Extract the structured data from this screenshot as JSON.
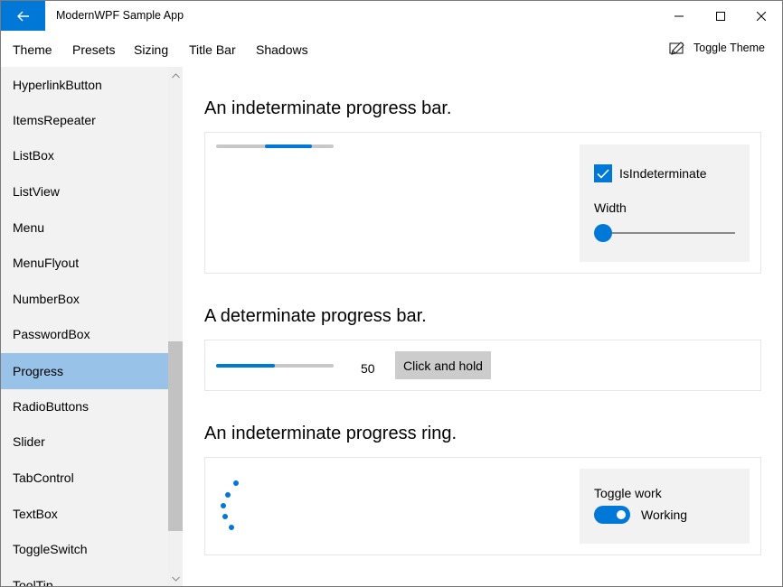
{
  "titlebar": {
    "title": "ModernWPF Sample App",
    "back_icon": "arrow-left-icon",
    "minimize_icon": "minimize-icon",
    "maximize_icon": "maximize-icon",
    "close_icon": "close-icon",
    "accent": "#0078d7"
  },
  "menu": {
    "items": [
      {
        "label": "Theme"
      },
      {
        "label": "Presets"
      },
      {
        "label": "Sizing"
      },
      {
        "label": "Title Bar"
      },
      {
        "label": "Shadows"
      }
    ],
    "toggle_theme_label": "Toggle Theme",
    "toggle_theme_icon": "theme-toggle-icon"
  },
  "sidebar": {
    "items": [
      {
        "label": "HyperlinkButton"
      },
      {
        "label": "ItemsRepeater"
      },
      {
        "label": "ListBox"
      },
      {
        "label": "ListView"
      },
      {
        "label": "Menu"
      },
      {
        "label": "MenuFlyout"
      },
      {
        "label": "NumberBox"
      },
      {
        "label": "PasswordBox"
      },
      {
        "label": "Progress"
      },
      {
        "label": "RadioButtons"
      },
      {
        "label": "Slider"
      },
      {
        "label": "TabControl"
      },
      {
        "label": "TextBox"
      },
      {
        "label": "ToggleSwitch"
      },
      {
        "label": "ToolTip"
      }
    ],
    "selected": "Progress",
    "selected_color": "#99c2e8"
  },
  "sections": {
    "indeterminate_bar": {
      "title": "An indeterminate progress bar.",
      "checkbox_label": "IsIndeterminate",
      "checkbox_checked": true,
      "width_label": "Width",
      "width_slider_value": 0
    },
    "determinate_bar": {
      "title": "A determinate progress bar.",
      "value": "50",
      "progress_fraction": 0.5,
      "button_label": "Click and hold"
    },
    "progress_ring": {
      "title": "An indeterminate progress ring.",
      "toggle_header": "Toggle work",
      "toggle_state_label": "Working",
      "toggle_on": true
    }
  }
}
